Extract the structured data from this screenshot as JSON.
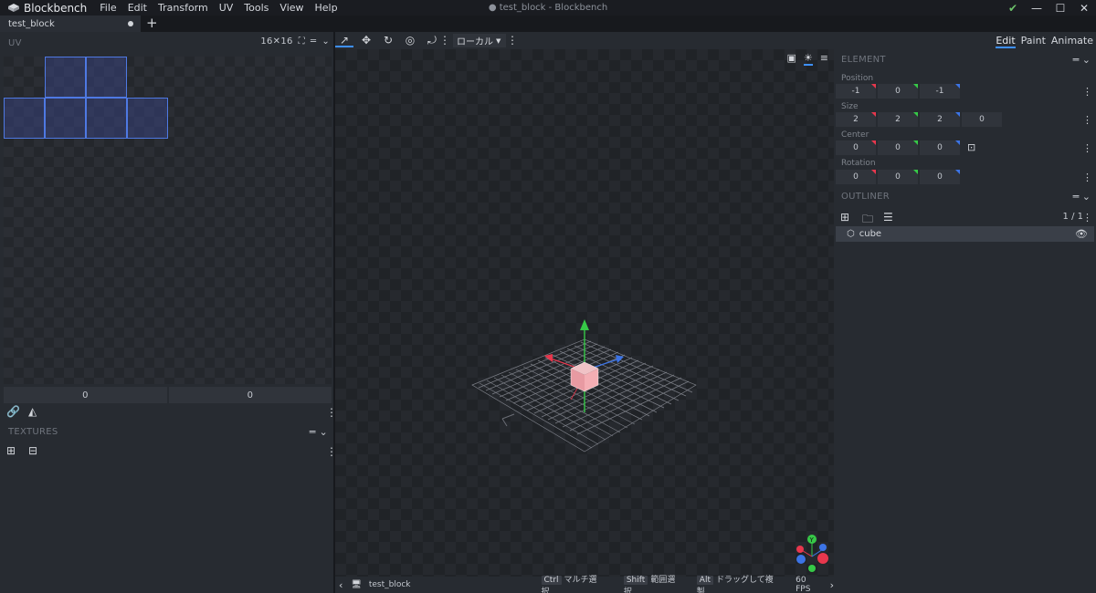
{
  "app": {
    "name": "Blockbench",
    "window_title": "● test_block - Blockbench",
    "menu": [
      "File",
      "Edit",
      "Transform",
      "UV",
      "Tools",
      "View",
      "Help"
    ]
  },
  "tabs": [
    {
      "label": "test_block"
    }
  ],
  "uv_panel": {
    "title": "UV",
    "size_label": "16✕16",
    "field_values": [
      "0",
      "0"
    ]
  },
  "textures_panel": {
    "title": "TEXTURES"
  },
  "viewport": {
    "space_label": "ローカル",
    "status": {
      "file": "test_block",
      "hints": [
        {
          "key": "Ctrl",
          "text": "マルチ選択"
        },
        {
          "key": "Shift",
          "text": "範囲選択"
        },
        {
          "key": "Alt",
          "text": "ドラッグして複製"
        }
      ],
      "fps": "60 FPS"
    }
  },
  "modes": {
    "items": [
      "Edit",
      "Paint",
      "Animate"
    ],
    "selected": "Edit"
  },
  "element_panel": {
    "title": "ELEMENT",
    "position": {
      "label": "Position",
      "values": [
        "-1",
        "0",
        "-1"
      ]
    },
    "size": {
      "label": "Size",
      "values": [
        "2",
        "2",
        "2",
        "0"
      ]
    },
    "center": {
      "label": "Center",
      "values": [
        "0",
        "0",
        "0"
      ]
    },
    "rotation": {
      "label": "Rotation",
      "values": [
        "0",
        "0",
        "0"
      ]
    }
  },
  "outliner": {
    "title": "OUTLINER",
    "count": "1 / 1",
    "items": [
      {
        "name": "cube"
      }
    ]
  },
  "colors": {
    "accent": "#3e90ff",
    "axis_x": "#e8374d",
    "axis_y": "#36c947",
    "axis_z": "#3c74e6",
    "uv_face": "#4e79e3"
  }
}
